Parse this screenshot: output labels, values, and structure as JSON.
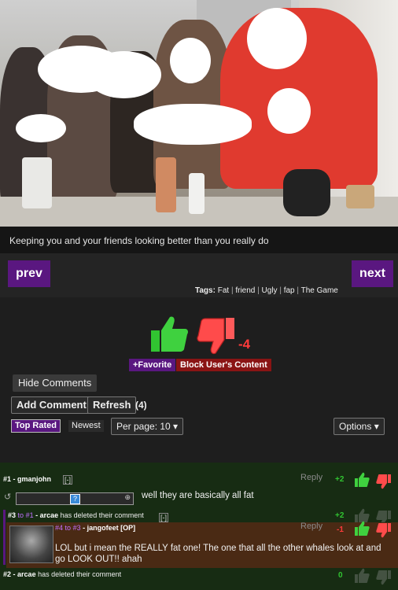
{
  "caption": "Keeping you and your friends looking better than you really do",
  "nav": {
    "prev": "prev",
    "next": "next"
  },
  "tags": {
    "label": "Tags:",
    "items": [
      "Fat",
      "friend",
      "Ugly",
      "fap",
      "The Game"
    ]
  },
  "votes": {
    "score": "-4"
  },
  "actions": {
    "favorite": "+Favorite",
    "block": "Block User's Content"
  },
  "comments_controls": {
    "hide": "Hide Comments",
    "add": "Add Comment",
    "refresh": "Refresh",
    "count": "(4)",
    "top_rated": "Top Rated",
    "newest": "Newest",
    "per_page": "Per page: 10 ▾",
    "options": "Options ▾"
  },
  "comments": [
    {
      "num": "#1",
      "sep": "-",
      "user": "gmanjohn",
      "toggle": "[-]",
      "reply": "Reply",
      "points": "+2",
      "text": "well they are basically all fat"
    },
    {
      "num": "#3",
      "to": "to",
      "ref": "#1",
      "user": "arcae",
      "text": "has deleted their comment",
      "toggle": "[-]",
      "points": "+2"
    },
    {
      "num": "#4",
      "to": "to",
      "ref": "#3",
      "user": "jangofeet [OP]",
      "reply": "Reply",
      "points": "-1",
      "text": "LOL but i mean the REALLY fat one! The one that all the other whales look at and go LOOK OUT!! ahah"
    },
    {
      "num": "#2",
      "user": "arcae",
      "text": "has deleted their comment",
      "points": "0"
    }
  ],
  "colors": {
    "purple": "#5a1780",
    "red": "#8a1414",
    "green": "#31c431",
    "score_red": "#ff3b3b",
    "comment_bg": "#172c13"
  }
}
